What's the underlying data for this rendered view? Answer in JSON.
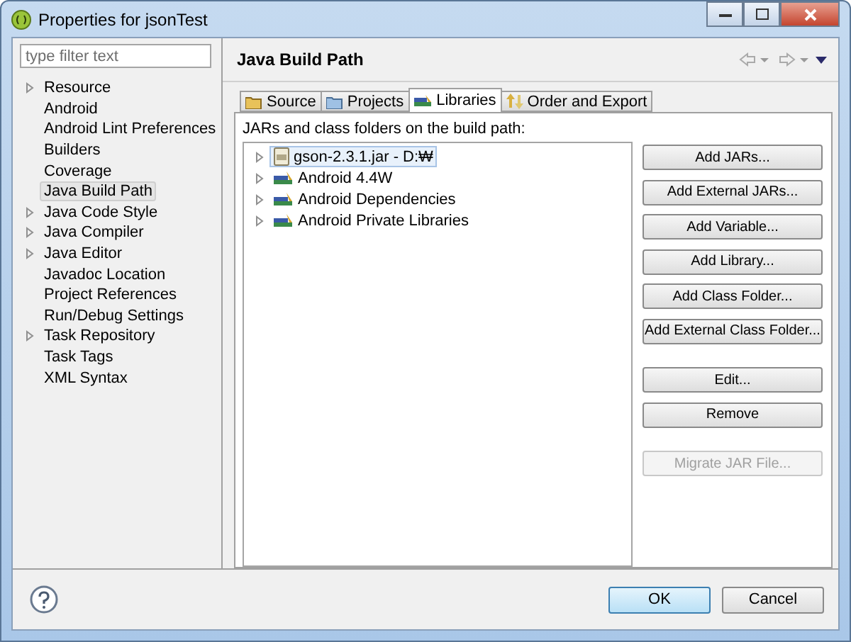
{
  "window": {
    "title": "Properties for jsonTest"
  },
  "filter": {
    "placeholder": "type filter text"
  },
  "nav_items": [
    {
      "label": "Resource",
      "expandable": true,
      "selected": false
    },
    {
      "label": "Android",
      "expandable": false,
      "selected": false
    },
    {
      "label": "Android Lint Preferences",
      "expandable": false,
      "selected": false
    },
    {
      "label": "Builders",
      "expandable": false,
      "selected": false
    },
    {
      "label": "Coverage",
      "expandable": false,
      "selected": false
    },
    {
      "label": "Java Build Path",
      "expandable": false,
      "selected": true
    },
    {
      "label": "Java Code Style",
      "expandable": true,
      "selected": false
    },
    {
      "label": "Java Compiler",
      "expandable": true,
      "selected": false
    },
    {
      "label": "Java Editor",
      "expandable": true,
      "selected": false
    },
    {
      "label": "Javadoc Location",
      "expandable": false,
      "selected": false
    },
    {
      "label": "Project References",
      "expandable": false,
      "selected": false
    },
    {
      "label": "Run/Debug Settings",
      "expandable": false,
      "selected": false
    },
    {
      "label": "Task Repository",
      "expandable": true,
      "selected": false
    },
    {
      "label": "Task Tags",
      "expandable": false,
      "selected": false
    },
    {
      "label": "XML Syntax",
      "expandable": false,
      "selected": false
    }
  ],
  "page": {
    "title": "Java Build Path"
  },
  "tabs": [
    {
      "label": "Source",
      "kind": "folder",
      "selected": false
    },
    {
      "label": "Projects",
      "kind": "project",
      "selected": false
    },
    {
      "label": "Libraries",
      "kind": "library",
      "selected": true
    },
    {
      "label": "Order and Export",
      "kind": "order",
      "selected": false
    }
  ],
  "content_label": "JARs and class folders on the build path:",
  "tree_items": [
    {
      "label": "gson-2.3.1.jar - D:₩",
      "kind": "jar",
      "selected": true
    },
    {
      "label": "Android 4.4W",
      "kind": "library",
      "selected": false
    },
    {
      "label": "Android Dependencies",
      "kind": "library",
      "selected": false
    },
    {
      "label": "Android Private Libraries",
      "kind": "library",
      "selected": false
    }
  ],
  "button_groups": [
    [
      {
        "label": "Add JARs...",
        "disabled": false
      },
      {
        "label": "Add External JARs...",
        "disabled": false
      },
      {
        "label": "Add Variable...",
        "disabled": false
      },
      {
        "label": "Add Library...",
        "disabled": false
      },
      {
        "label": "Add Class Folder...",
        "disabled": false
      },
      {
        "label": "Add External Class Folder...",
        "disabled": false
      }
    ],
    [
      {
        "label": "Edit...",
        "disabled": false
      },
      {
        "label": "Remove",
        "disabled": false
      }
    ],
    [
      {
        "label": "Migrate JAR File...",
        "disabled": true
      }
    ]
  ],
  "dialog_buttons": [
    {
      "label": "OK",
      "default": true
    },
    {
      "label": "Cancel",
      "default": false
    }
  ]
}
